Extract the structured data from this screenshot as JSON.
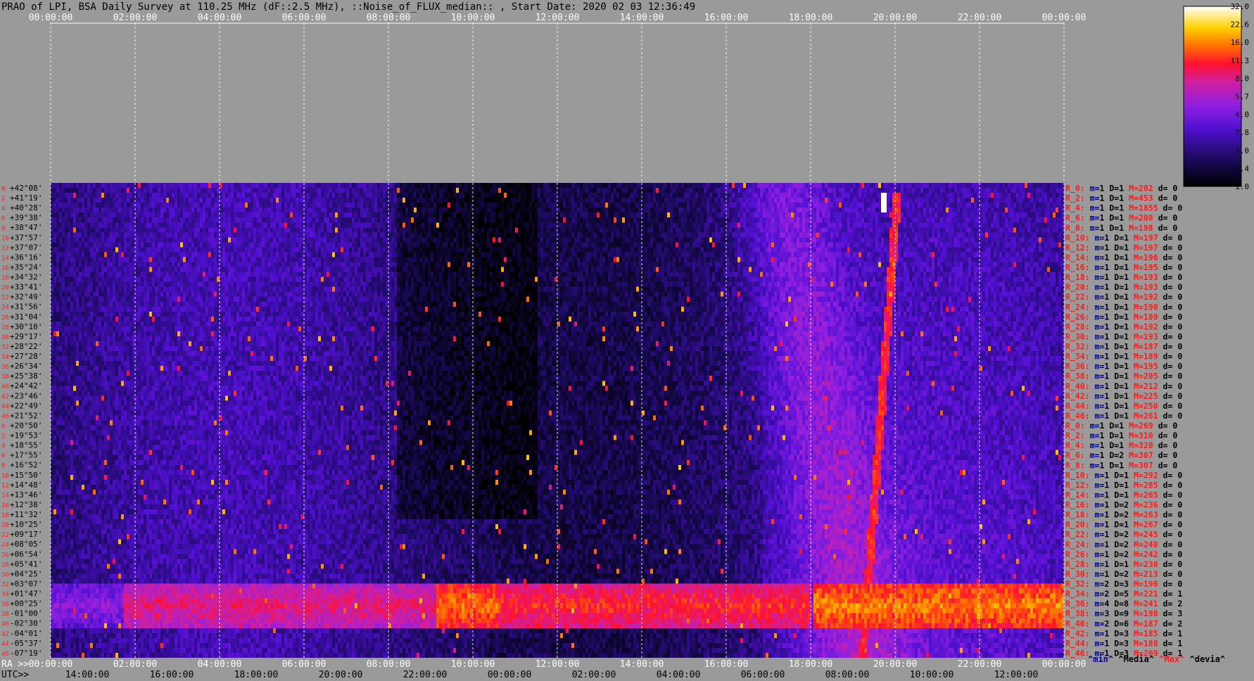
{
  "chart_data": {
    "type": "heatmap",
    "title": "PRAO of LPI, BSA Daily Survey at 110.25 MHz (dF::2.5 MHz), ::Noise_of_FLUX_median:: , Start Date: 2020 02 03 12:36:49",
    "top_time_ticks": [
      "00:00:00",
      "02:00:00",
      "04:00:00",
      "06:00:00",
      "08:00:00",
      "10:00:00",
      "12:00:00",
      "14:00:00",
      "16:00:00",
      "18:00:00",
      "20:00:00",
      "22:00:00",
      "00:00:00"
    ],
    "ra_prefix": "RA >>",
    "ra_ticks": [
      "00:00:00",
      "02:00:00",
      "04:00:00",
      "06:00:00",
      "08:00:00",
      "10:00:00",
      "12:00:00",
      "14:00:00",
      "16:00:00",
      "18:00:00",
      "20:00:00",
      "22:00:00",
      "00:00:00"
    ],
    "utc_prefix": "UTC>>",
    "utc_ticks": [
      "14:00:00",
      "16:00:00",
      "18:00:00",
      "20:00:00",
      "22:00:00",
      "00:00:00",
      "02:00:00",
      "04:00:00",
      "06:00:00",
      "08:00:00",
      "10:00:00",
      "12:00:00"
    ],
    "colorbar_ticks": [
      "32.0",
      "22.6",
      "16.0",
      "11.3",
      "8.0",
      "5.7",
      "4.0",
      "2.8",
      "2.0",
      "1.4",
      "1.0"
    ],
    "colorbar_scale": "log",
    "colorbar_range": [
      1.0,
      32.0
    ],
    "declinations": [
      "+42°08'",
      "+41°19'",
      "+40°28'",
      "+39°38'",
      "+38°47'",
      "+37°57'",
      "+37°07'",
      "+36°16'",
      "+35°24'",
      "+34°32'",
      "+33°41'",
      "+32°49'",
      "+31°56'",
      "+31°04'",
      "+30°10'",
      "+29°17'",
      "+28°22'",
      "+27°28'",
      "+26°34'",
      "+25°38'",
      "+24°42'",
      "+23°46'",
      "+22°49'",
      "+21°52'",
      "+20°50'",
      "+19°53'",
      "+18°55'",
      "+17°55'",
      "+16°52'",
      "+15°50'",
      "+14°48'",
      "+13°46'",
      "+12°38'",
      "+11°32'",
      "+10°25'",
      "+09°17'",
      "+08°05'",
      "+06°54'",
      "+05°41'",
      "+04°25'",
      "+03°07'",
      "+01°47'",
      "+00°25'",
      "-01°00'",
      "-02°30'",
      "-04°01'",
      "-05°37'",
      "-07°19'"
    ],
    "row_numbers": [
      "0",
      "2",
      "4",
      "6",
      "8",
      "10",
      "12",
      "14",
      "16",
      "18",
      "20",
      "22",
      "24",
      "26",
      "28",
      "30",
      "32",
      "34",
      "36",
      "38",
      "40",
      "42",
      "44",
      "46",
      "0",
      "2",
      "4",
      "6",
      "8",
      "10",
      "12",
      "14",
      "16",
      "18",
      "20",
      "22",
      "24",
      "26",
      "28",
      "30",
      "32",
      "34",
      "36",
      "38",
      "40",
      "42",
      "44",
      "46"
    ],
    "stats": [
      {
        "r": "R_0:",
        "m": "1",
        "D": "1",
        "M": "202",
        "d": "0"
      },
      {
        "r": "R_2:",
        "m": "1",
        "D": "1",
        "M": "453",
        "d": "0"
      },
      {
        "r": "R_4:",
        "m": "1",
        "D": "1",
        "M": "1855",
        "d": "0"
      },
      {
        "r": "R_6:",
        "m": "1",
        "D": "1",
        "M": "208",
        "d": "0"
      },
      {
        "r": "R_8:",
        "m": "1",
        "D": "1",
        "M": "198",
        "d": "0"
      },
      {
        "r": "R_10:",
        "m": "1",
        "D": "1",
        "M": "197",
        "d": "0"
      },
      {
        "r": "R_12:",
        "m": "1",
        "D": "1",
        "M": "197",
        "d": "0"
      },
      {
        "r": "R_14:",
        "m": "1",
        "D": "1",
        "M": "196",
        "d": "0"
      },
      {
        "r": "R_16:",
        "m": "1",
        "D": "1",
        "M": "195",
        "d": "0"
      },
      {
        "r": "R_18:",
        "m": "1",
        "D": "1",
        "M": "193",
        "d": "0"
      },
      {
        "r": "R_20:",
        "m": "1",
        "D": "1",
        "M": "193",
        "d": "0"
      },
      {
        "r": "R_22:",
        "m": "1",
        "D": "1",
        "M": "192",
        "d": "0"
      },
      {
        "r": "R_24:",
        "m": "1",
        "D": "1",
        "M": "190",
        "d": "0"
      },
      {
        "r": "R_26:",
        "m": "1",
        "D": "1",
        "M": "189",
        "d": "0"
      },
      {
        "r": "R_28:",
        "m": "1",
        "D": "1",
        "M": "192",
        "d": "0"
      },
      {
        "r": "R_30:",
        "m": "1",
        "D": "1",
        "M": "193",
        "d": "0"
      },
      {
        "r": "R_32:",
        "m": "1",
        "D": "1",
        "M": "187",
        "d": "0"
      },
      {
        "r": "R_34:",
        "m": "1",
        "D": "1",
        "M": "189",
        "d": "0"
      },
      {
        "r": "R_36:",
        "m": "1",
        "D": "1",
        "M": "195",
        "d": "0"
      },
      {
        "r": "R_38:",
        "m": "1",
        "D": "1",
        "M": "205",
        "d": "0"
      },
      {
        "r": "R_40:",
        "m": "1",
        "D": "1",
        "M": "212",
        "d": "0"
      },
      {
        "r": "R_42:",
        "m": "1",
        "D": "1",
        "M": "225",
        "d": "0"
      },
      {
        "r": "R_44:",
        "m": "1",
        "D": "1",
        "M": "250",
        "d": "0"
      },
      {
        "r": "R_46:",
        "m": "1",
        "D": "1",
        "M": "261",
        "d": "0"
      },
      {
        "r": "R_0:",
        "m": "1",
        "D": "1",
        "M": "269",
        "d": "0"
      },
      {
        "r": "R_2:",
        "m": "1",
        "D": "1",
        "M": "310",
        "d": "0"
      },
      {
        "r": "R_4:",
        "m": "1",
        "D": "1",
        "M": "320",
        "d": "0"
      },
      {
        "r": "R_6:",
        "m": "1",
        "D": "2",
        "M": "307",
        "d": "0"
      },
      {
        "r": "R_8:",
        "m": "1",
        "D": "1",
        "M": "307",
        "d": "0"
      },
      {
        "r": "R_10:",
        "m": "1",
        "D": "1",
        "M": "292",
        "d": "0"
      },
      {
        "r": "R_12:",
        "m": "1",
        "D": "1",
        "M": "285",
        "d": "0"
      },
      {
        "r": "R_14:",
        "m": "1",
        "D": "1",
        "M": "265",
        "d": "0"
      },
      {
        "r": "R_16:",
        "m": "1",
        "D": "2",
        "M": "236",
        "d": "0"
      },
      {
        "r": "R_18:",
        "m": "1",
        "D": "2",
        "M": "263",
        "d": "0"
      },
      {
        "r": "R_20:",
        "m": "1",
        "D": "1",
        "M": "267",
        "d": "0"
      },
      {
        "r": "R_22:",
        "m": "1",
        "D": "2",
        "M": "245",
        "d": "0"
      },
      {
        "r": "R_24:",
        "m": "1",
        "D": "2",
        "M": "240",
        "d": "0"
      },
      {
        "r": "R_26:",
        "m": "1",
        "D": "2",
        "M": "242",
        "d": "0"
      },
      {
        "r": "R_28:",
        "m": "1",
        "D": "1",
        "M": "230",
        "d": "0"
      },
      {
        "r": "R_30:",
        "m": "1",
        "D": "2",
        "M": "213",
        "d": "0"
      },
      {
        "r": "R_32:",
        "m": "2",
        "D": "3",
        "M": "196",
        "d": "0"
      },
      {
        "r": "R_34:",
        "m": "2",
        "D": "5",
        "M": "221",
        "d": "1"
      },
      {
        "r": "R_36:",
        "m": "4",
        "D": "8",
        "M": "241",
        "d": "2"
      },
      {
        "r": "R_38:",
        "m": "3",
        "D": "9",
        "M": "198",
        "d": "3"
      },
      {
        "r": "R_40:",
        "m": "2",
        "D": "6",
        "M": "187",
        "d": "2"
      },
      {
        "r": "R_42:",
        "m": "1",
        "D": "3",
        "M": "185",
        "d": "1"
      },
      {
        "r": "R_44:",
        "m": "1",
        "D": "3",
        "M": "188",
        "d": "1"
      },
      {
        "r": "R_46:",
        "m": "1",
        "D": "3",
        "M": "269",
        "d": "1"
      }
    ],
    "stat_legend": {
      "min": "^min^",
      "median": "^Media^",
      "max": "^Max^",
      "devia": "^devia^"
    },
    "colors": {
      "background": "#9a9a9a",
      "stat_label": "#ff1a1a",
      "stat_value": "#000000",
      "row_number": "#ff2020",
      "legend_min": "#00008b",
      "legend_max": "#ff1a1a"
    }
  }
}
